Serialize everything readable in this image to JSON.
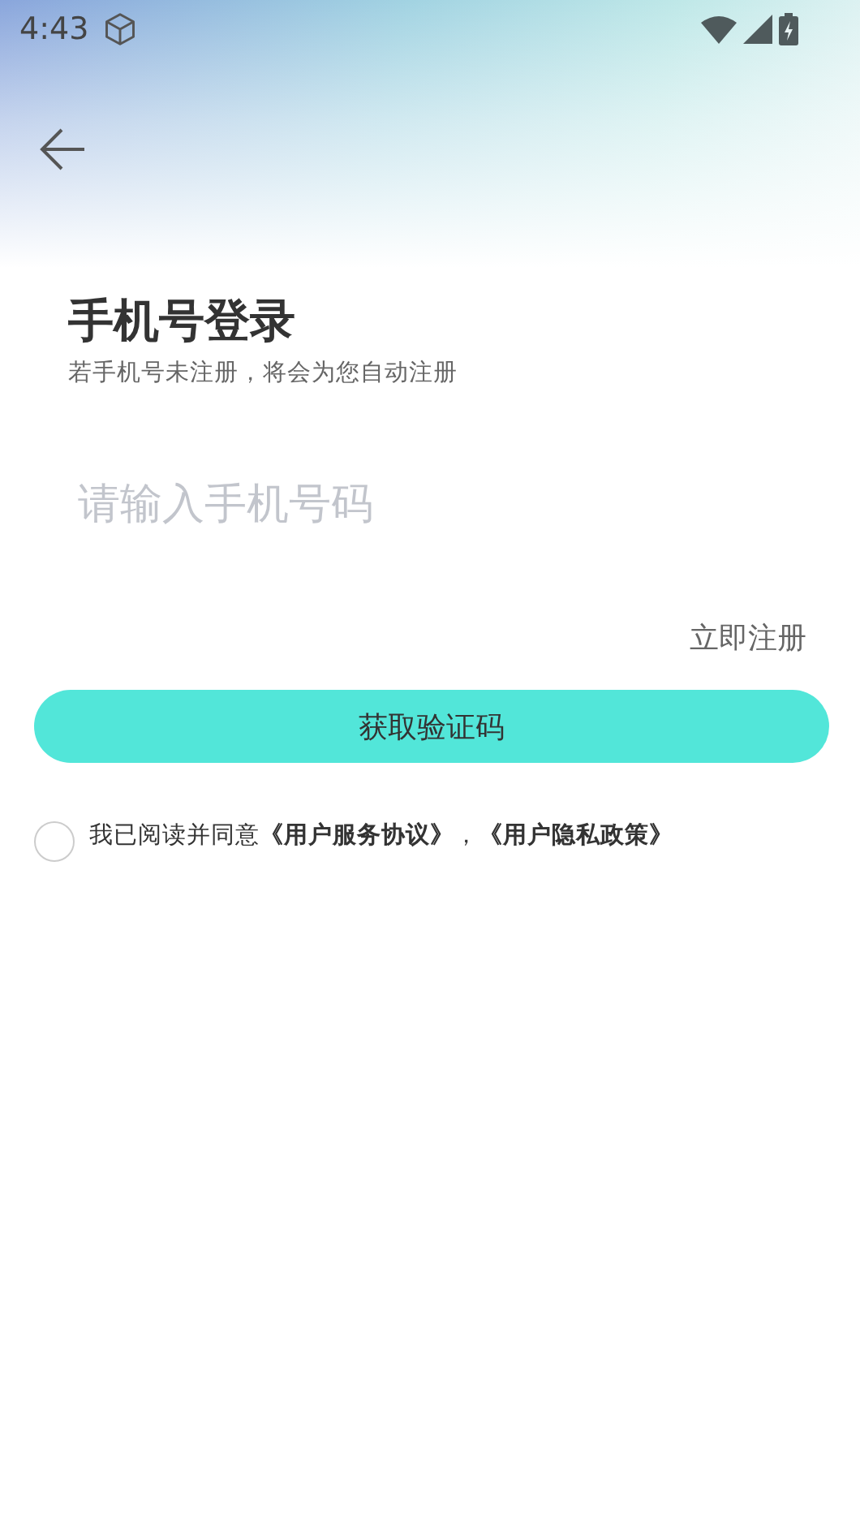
{
  "status_bar": {
    "time": "4:43"
  },
  "title": "手机号登录",
  "subtitle": "若手机号未注册，将会为您自动注册",
  "phone_field": {
    "placeholder": "请输入手机号码"
  },
  "register_link": "立即注册",
  "submit_button": "获取验证码",
  "agreement": {
    "checked": false,
    "text": "我已阅读并同意",
    "links": [
      "《用户服务协议》",
      "《用户隐私政策》"
    ],
    "separator": "，"
  }
}
